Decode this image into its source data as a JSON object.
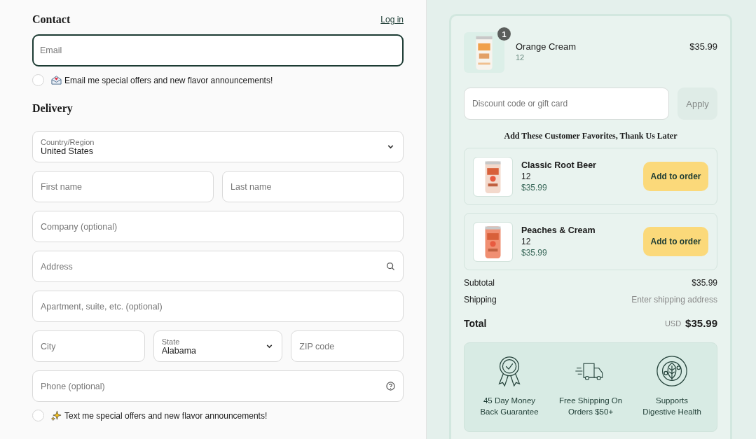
{
  "contact": {
    "title": "Contact",
    "login_link": "Log in",
    "email": {
      "placeholder": "Email"
    },
    "opt_in": {
      "label": "Email me special offers and new flavor announcements!",
      "checked": false
    }
  },
  "delivery": {
    "title": "Delivery",
    "rows": [
      [
        {
          "kind": "select",
          "label": "Country/Region",
          "value": "United States"
        }
      ],
      [
        {
          "kind": "text",
          "placeholder": "First name"
        },
        {
          "kind": "text",
          "placeholder": "Last name"
        }
      ],
      [
        {
          "kind": "text",
          "placeholder": "Company (optional)"
        }
      ],
      [
        {
          "kind": "search",
          "placeholder": "Address"
        }
      ],
      [
        {
          "kind": "text",
          "placeholder": "Apartment, suite, etc. (optional)"
        }
      ],
      [
        {
          "kind": "text",
          "placeholder": "City"
        },
        {
          "kind": "select",
          "label": "State",
          "value": "Alabama"
        },
        {
          "kind": "text",
          "placeholder": "ZIP code"
        }
      ],
      [
        {
          "kind": "help",
          "placeholder": "Phone (optional)"
        }
      ]
    ],
    "sms_opt_in": {
      "label": "Text me special offers and new flavor announcements!",
      "checked": false
    }
  },
  "cart": {
    "items": [
      {
        "quantity": "1",
        "name": "Orange Cream",
        "variant": "12",
        "price": "$35.99"
      }
    ],
    "discount": {
      "placeholder": "Discount code or gift card",
      "button": "Apply",
      "disabled": true
    },
    "upsell_title": "Add These Customer Favorites, Thank Us Later",
    "upsells": [
      {
        "name": "Classic Root Beer",
        "variant": "12",
        "price": "$35.99",
        "button": "Add to order",
        "color": "#f3d9cc"
      },
      {
        "name": "Peaches & Cream",
        "variant": "12",
        "price": "$35.99",
        "button": "Add to order",
        "color": "#f08f72"
      }
    ],
    "summary": [
      {
        "label": "Subtotal",
        "value": "$35.99",
        "muted": false
      },
      {
        "label": "Shipping",
        "value": "Enter shipping address",
        "muted": true
      }
    ],
    "total": {
      "label": "Total",
      "currency": "USD",
      "value": "$35.99"
    },
    "perks": [
      {
        "kind": "award",
        "text": "45 Day Money Back Guarantee"
      },
      {
        "kind": "truck",
        "text": "Free Shipping On Orders $50+"
      },
      {
        "kind": "seal",
        "text": "Supports Digestive Health"
      }
    ]
  }
}
